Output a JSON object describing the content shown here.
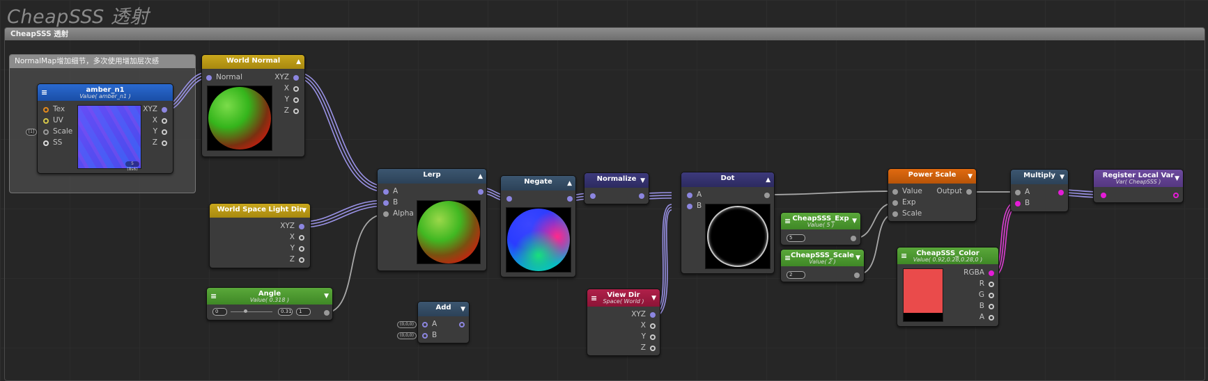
{
  "title": "CheapSSS 透射",
  "group_label": "CheapSSS 透射",
  "comment_label": "NormalMap增加细节，多次使用增加层次感",
  "nodes": {
    "amber": {
      "title": "amber_n1",
      "subtitle": "Value( amber_n1 )",
      "inputs": [
        "Tex",
        "UV",
        "Scale",
        "SS"
      ],
      "outputs": [
        "XYZ",
        "X",
        "Y",
        "Z"
      ],
      "tiny_label": "[1]",
      "tex_badge": "5 (8s6)"
    },
    "world_normal": {
      "title": "World Normal",
      "inputs": [
        "Normal"
      ],
      "outputs": [
        "XYZ",
        "X",
        "Y",
        "Z"
      ]
    },
    "world_light": {
      "title": "World Space Light Dir",
      "outputs": [
        "XYZ",
        "X",
        "Y",
        "Z"
      ]
    },
    "angle": {
      "title": "Angle",
      "subtitle": "Value( 0.318 )",
      "slider_min": "0",
      "slider_val": "0.31",
      "slider_max": "1"
    },
    "lerp": {
      "title": "Lerp",
      "inputs": [
        "A",
        "B",
        "Alpha"
      ]
    },
    "add": {
      "title": "Add",
      "inputs": [
        "A",
        "B"
      ],
      "tag_a": "(0,0,0)",
      "tag_b": "(0,0,0)"
    },
    "negate": {
      "title": "Negate"
    },
    "normalize": {
      "title": "Normalize"
    },
    "view_dir": {
      "title": "View Dir",
      "subtitle": "Space( World )",
      "outputs": [
        "XYZ",
        "X",
        "Y",
        "Z"
      ]
    },
    "dot": {
      "title": "Dot",
      "inputs": [
        "A",
        "B"
      ]
    },
    "exp": {
      "title": "CheapSSS_Exp",
      "subtitle": "Value( 5 )",
      "value": "5"
    },
    "scale": {
      "title": "CheapSSS_Scale",
      "subtitle": "Value( 2 )",
      "value": "2"
    },
    "power": {
      "title": "Power Scale",
      "inputs": [
        "Value",
        "Exp",
        "Scale"
      ],
      "output": "Output"
    },
    "color": {
      "title": "CheapSSS_Color",
      "subtitle": "Value( 0.92,0.28,0.28,0 )",
      "outputs": [
        "RGBA",
        "R",
        "G",
        "B",
        "A"
      ],
      "swatch": "#ea4b4b"
    },
    "multiply": {
      "title": "Multiply",
      "inputs": [
        "A",
        "B"
      ]
    },
    "register": {
      "title": "Register Local Var",
      "subtitle": "Var( CheapSSS )"
    }
  },
  "colors": {
    "vec_port": "#8c86e0",
    "float_port": "#9a9a9a",
    "color_port": "#e51cd8",
    "tex_port": "#e58a1b",
    "uv_port": "#d7c84a",
    "wire_vec": "#9a92e6",
    "wire_float": "#a0a0a0",
    "wire_color": "#dd3fd3"
  }
}
